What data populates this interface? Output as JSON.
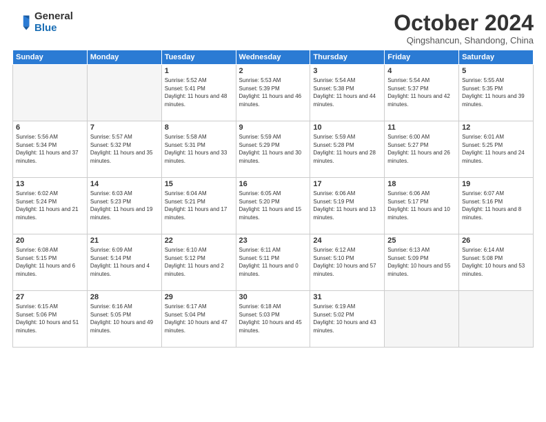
{
  "logo": {
    "general": "General",
    "blue": "Blue"
  },
  "title": "October 2024",
  "location": "Qingshancun, Shandong, China",
  "days_of_week": [
    "Sunday",
    "Monday",
    "Tuesday",
    "Wednesday",
    "Thursday",
    "Friday",
    "Saturday"
  ],
  "weeks": [
    [
      {
        "day": "",
        "sunrise": "",
        "sunset": "",
        "daylight": ""
      },
      {
        "day": "",
        "sunrise": "",
        "sunset": "",
        "daylight": ""
      },
      {
        "day": "1",
        "sunrise": "Sunrise: 5:52 AM",
        "sunset": "Sunset: 5:41 PM",
        "daylight": "Daylight: 11 hours and 48 minutes."
      },
      {
        "day": "2",
        "sunrise": "Sunrise: 5:53 AM",
        "sunset": "Sunset: 5:39 PM",
        "daylight": "Daylight: 11 hours and 46 minutes."
      },
      {
        "day": "3",
        "sunrise": "Sunrise: 5:54 AM",
        "sunset": "Sunset: 5:38 PM",
        "daylight": "Daylight: 11 hours and 44 minutes."
      },
      {
        "day": "4",
        "sunrise": "Sunrise: 5:54 AM",
        "sunset": "Sunset: 5:37 PM",
        "daylight": "Daylight: 11 hours and 42 minutes."
      },
      {
        "day": "5",
        "sunrise": "Sunrise: 5:55 AM",
        "sunset": "Sunset: 5:35 PM",
        "daylight": "Daylight: 11 hours and 39 minutes."
      }
    ],
    [
      {
        "day": "6",
        "sunrise": "Sunrise: 5:56 AM",
        "sunset": "Sunset: 5:34 PM",
        "daylight": "Daylight: 11 hours and 37 minutes."
      },
      {
        "day": "7",
        "sunrise": "Sunrise: 5:57 AM",
        "sunset": "Sunset: 5:32 PM",
        "daylight": "Daylight: 11 hours and 35 minutes."
      },
      {
        "day": "8",
        "sunrise": "Sunrise: 5:58 AM",
        "sunset": "Sunset: 5:31 PM",
        "daylight": "Daylight: 11 hours and 33 minutes."
      },
      {
        "day": "9",
        "sunrise": "Sunrise: 5:59 AM",
        "sunset": "Sunset: 5:29 PM",
        "daylight": "Daylight: 11 hours and 30 minutes."
      },
      {
        "day": "10",
        "sunrise": "Sunrise: 5:59 AM",
        "sunset": "Sunset: 5:28 PM",
        "daylight": "Daylight: 11 hours and 28 minutes."
      },
      {
        "day": "11",
        "sunrise": "Sunrise: 6:00 AM",
        "sunset": "Sunset: 5:27 PM",
        "daylight": "Daylight: 11 hours and 26 minutes."
      },
      {
        "day": "12",
        "sunrise": "Sunrise: 6:01 AM",
        "sunset": "Sunset: 5:25 PM",
        "daylight": "Daylight: 11 hours and 24 minutes."
      }
    ],
    [
      {
        "day": "13",
        "sunrise": "Sunrise: 6:02 AM",
        "sunset": "Sunset: 5:24 PM",
        "daylight": "Daylight: 11 hours and 21 minutes."
      },
      {
        "day": "14",
        "sunrise": "Sunrise: 6:03 AM",
        "sunset": "Sunset: 5:23 PM",
        "daylight": "Daylight: 11 hours and 19 minutes."
      },
      {
        "day": "15",
        "sunrise": "Sunrise: 6:04 AM",
        "sunset": "Sunset: 5:21 PM",
        "daylight": "Daylight: 11 hours and 17 minutes."
      },
      {
        "day": "16",
        "sunrise": "Sunrise: 6:05 AM",
        "sunset": "Sunset: 5:20 PM",
        "daylight": "Daylight: 11 hours and 15 minutes."
      },
      {
        "day": "17",
        "sunrise": "Sunrise: 6:06 AM",
        "sunset": "Sunset: 5:19 PM",
        "daylight": "Daylight: 11 hours and 13 minutes."
      },
      {
        "day": "18",
        "sunrise": "Sunrise: 6:06 AM",
        "sunset": "Sunset: 5:17 PM",
        "daylight": "Daylight: 11 hours and 10 minutes."
      },
      {
        "day": "19",
        "sunrise": "Sunrise: 6:07 AM",
        "sunset": "Sunset: 5:16 PM",
        "daylight": "Daylight: 11 hours and 8 minutes."
      }
    ],
    [
      {
        "day": "20",
        "sunrise": "Sunrise: 6:08 AM",
        "sunset": "Sunset: 5:15 PM",
        "daylight": "Daylight: 11 hours and 6 minutes."
      },
      {
        "day": "21",
        "sunrise": "Sunrise: 6:09 AM",
        "sunset": "Sunset: 5:14 PM",
        "daylight": "Daylight: 11 hours and 4 minutes."
      },
      {
        "day": "22",
        "sunrise": "Sunrise: 6:10 AM",
        "sunset": "Sunset: 5:12 PM",
        "daylight": "Daylight: 11 hours and 2 minutes."
      },
      {
        "day": "23",
        "sunrise": "Sunrise: 6:11 AM",
        "sunset": "Sunset: 5:11 PM",
        "daylight": "Daylight: 11 hours and 0 minutes."
      },
      {
        "day": "24",
        "sunrise": "Sunrise: 6:12 AM",
        "sunset": "Sunset: 5:10 PM",
        "daylight": "Daylight: 10 hours and 57 minutes."
      },
      {
        "day": "25",
        "sunrise": "Sunrise: 6:13 AM",
        "sunset": "Sunset: 5:09 PM",
        "daylight": "Daylight: 10 hours and 55 minutes."
      },
      {
        "day": "26",
        "sunrise": "Sunrise: 6:14 AM",
        "sunset": "Sunset: 5:08 PM",
        "daylight": "Daylight: 10 hours and 53 minutes."
      }
    ],
    [
      {
        "day": "27",
        "sunrise": "Sunrise: 6:15 AM",
        "sunset": "Sunset: 5:06 PM",
        "daylight": "Daylight: 10 hours and 51 minutes."
      },
      {
        "day": "28",
        "sunrise": "Sunrise: 6:16 AM",
        "sunset": "Sunset: 5:05 PM",
        "daylight": "Daylight: 10 hours and 49 minutes."
      },
      {
        "day": "29",
        "sunrise": "Sunrise: 6:17 AM",
        "sunset": "Sunset: 5:04 PM",
        "daylight": "Daylight: 10 hours and 47 minutes."
      },
      {
        "day": "30",
        "sunrise": "Sunrise: 6:18 AM",
        "sunset": "Sunset: 5:03 PM",
        "daylight": "Daylight: 10 hours and 45 minutes."
      },
      {
        "day": "31",
        "sunrise": "Sunrise: 6:19 AM",
        "sunset": "Sunset: 5:02 PM",
        "daylight": "Daylight: 10 hours and 43 minutes."
      },
      {
        "day": "",
        "sunrise": "",
        "sunset": "",
        "daylight": ""
      },
      {
        "day": "",
        "sunrise": "",
        "sunset": "",
        "daylight": ""
      }
    ]
  ]
}
